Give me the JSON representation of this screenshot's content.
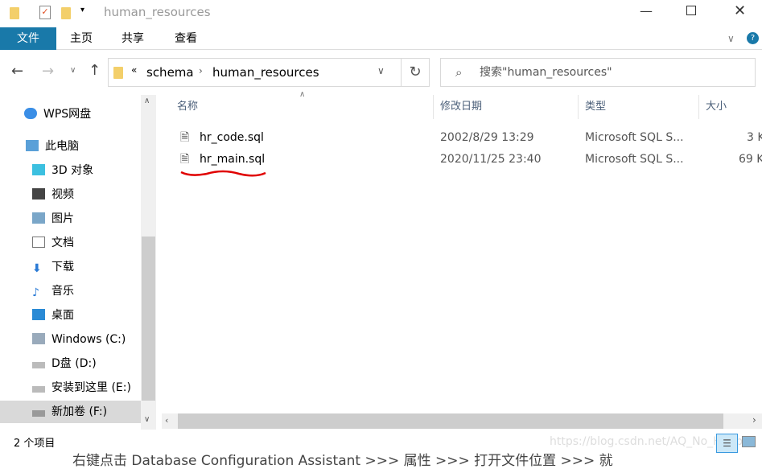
{
  "window": {
    "title": "human_resources"
  },
  "ribbon": {
    "tabs": [
      "文件",
      "主页",
      "共享",
      "查看"
    ]
  },
  "address": {
    "overflow": "«",
    "crumbs": [
      "schema",
      "human_resources"
    ]
  },
  "search": {
    "placeholder": "搜索\"human_resources\""
  },
  "sidebar": {
    "items": [
      "WPS网盘",
      "此电脑",
      "3D 对象",
      "视频",
      "图片",
      "文档",
      "下载",
      "音乐",
      "桌面",
      "Windows (C:)",
      "D盘 (D:)",
      "安装到这里 (E:)",
      "新加卷 (F:)"
    ]
  },
  "columns": [
    "名称",
    "修改日期",
    "类型",
    "大小"
  ],
  "files": [
    {
      "name": "hr_code.sql",
      "date": "2002/8/29 13:29",
      "type": "Microsoft SQL S...",
      "size": "3 K"
    },
    {
      "name": "hr_main.sql",
      "date": "2020/11/25 23:40",
      "type": "Microsoft SQL S...",
      "size": "69 K"
    }
  ],
  "status": {
    "count": "2 个项目",
    "watermark": "https://blog.csdn.net/AQ_No_Happy",
    "behind_text": "右键点击 Database Configuration Assistant >>> 属性 >>> 打开文件位置 >>> 就"
  },
  "colors": {
    "accent": "#1979a9",
    "annotation": "#e00000"
  }
}
